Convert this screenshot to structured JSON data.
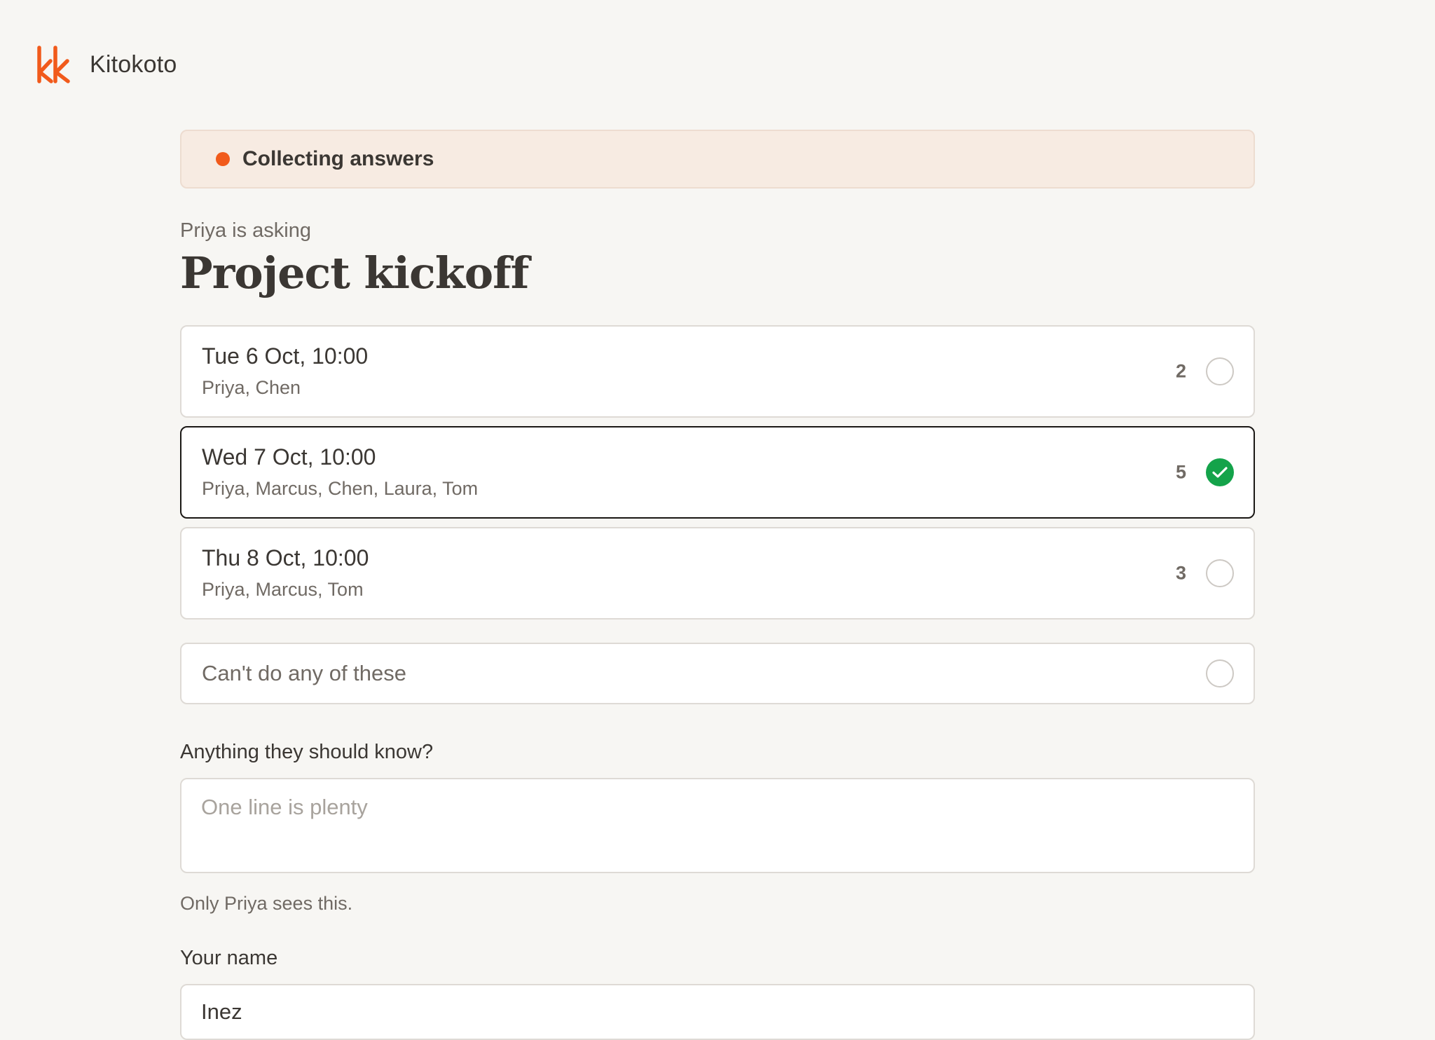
{
  "app": {
    "name": "Kitokoto",
    "brand_color": "#f15a1b"
  },
  "status": {
    "label": "Collecting answers",
    "dot_color": "#f15a1b"
  },
  "poll": {
    "asker_text": "Priya is asking",
    "title": "Project kickoff"
  },
  "options": [
    {
      "date": "Tue 6 Oct, 10:00",
      "names": "Priya, Chen",
      "count": "2",
      "selected": false
    },
    {
      "date": "Wed 7 Oct, 10:00",
      "names": "Priya, Marcus, Chen, Laura, Tom",
      "count": "5",
      "selected": true
    },
    {
      "date": "Thu 8 Oct, 10:00",
      "names": "Priya, Marcus, Tom",
      "count": "3",
      "selected": false
    }
  ],
  "decline": {
    "label": "Can't do any of these",
    "selected": false
  },
  "note": {
    "label": "Anything they should know?",
    "placeholder": "One line is plenty",
    "value": "",
    "helper": "Only Priya sees this."
  },
  "name_field": {
    "label": "Your name",
    "value": "Inez"
  },
  "icons": {
    "logo": "kitokoto-logo-icon",
    "selected": "check-icon"
  },
  "colors": {
    "selected_check": "#14a34a",
    "banner_bg": "#f7ebe2",
    "page_bg": "#f7f6f3"
  }
}
